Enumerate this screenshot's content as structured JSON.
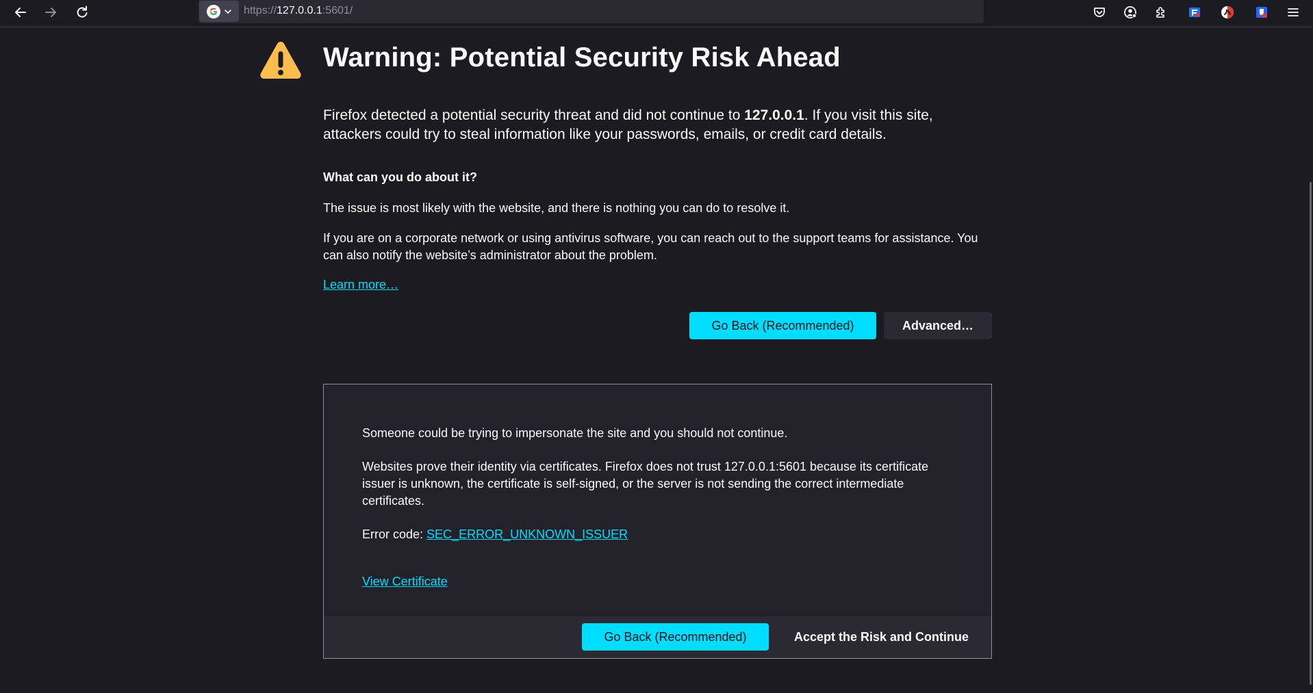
{
  "toolbar": {
    "url_scheme": "https://",
    "url_host": "127.0.0.1",
    "url_rest": ":5601/"
  },
  "page": {
    "title": "Warning: Potential Security Risk Ahead",
    "intro_prefix": "Firefox detected a potential security threat and did not continue to ",
    "intro_host": "127.0.0.1",
    "intro_suffix": ". If you visit this site, attackers could try to steal information like your passwords, emails, or credit card details.",
    "subhead": "What can you do about it?",
    "para1": "The issue is most likely with the website, and there is nothing you can do to resolve it.",
    "para2": "If you are on a corporate network or using antivirus software, you can reach out to the support teams for assistance. You can also notify the website’s administrator about the problem.",
    "learn_more": "Learn more…",
    "go_back_label": "Go Back (Recommended)",
    "advanced_label": "Advanced…"
  },
  "advanced": {
    "line1": "Someone could be trying to impersonate the site and you should not continue.",
    "line2": "Websites prove their identity via certificates. Firefox does not trust 127.0.0.1:5601 because its certificate issuer is unknown, the certificate is self-signed, or the server is not sending the correct intermediate certificates.",
    "error_prefix": "Error code: ",
    "error_code": "SEC_ERROR_UNKNOWN_ISSUER",
    "view_certificate": "View Certificate",
    "go_back_label": "Go Back (Recommended)",
    "accept_label": "Accept the Risk and Continue"
  },
  "colors": {
    "background": "#1c1b22",
    "accent": "#00ddff",
    "warning": "#ffbd4f"
  },
  "icons": [
    "back-arrow-icon",
    "forward-arrow-icon",
    "reload-icon",
    "google-icon",
    "chevron-down-icon",
    "pocket-icon",
    "account-icon",
    "extensions-icon",
    "warning-icon",
    "menu-icon"
  ]
}
